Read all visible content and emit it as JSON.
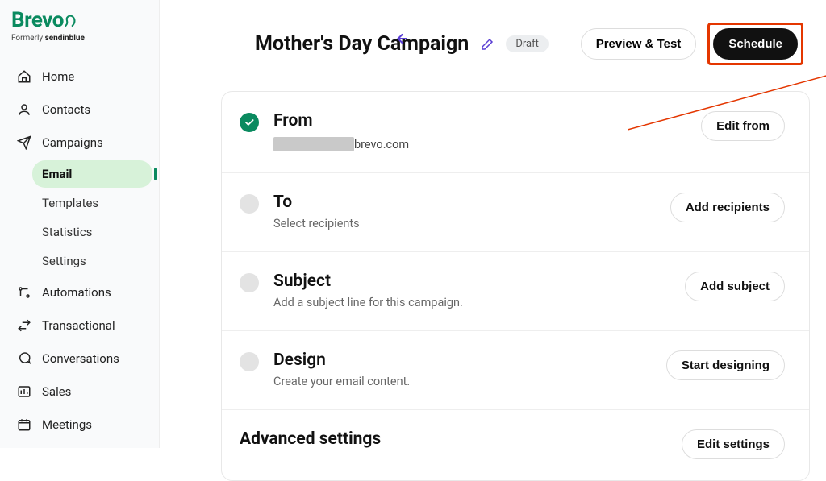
{
  "logo": {
    "name": "Brevo",
    "subline_prefix": "Formerly ",
    "subline_brand": "sendinblue"
  },
  "sidebar": {
    "items": [
      {
        "label": "Home"
      },
      {
        "label": "Contacts"
      },
      {
        "label": "Campaigns"
      },
      {
        "label": "Automations"
      },
      {
        "label": "Transactional"
      },
      {
        "label": "Conversations"
      },
      {
        "label": "Sales"
      },
      {
        "label": "Meetings"
      }
    ],
    "campaigns_sub": [
      {
        "label": "Email",
        "active": true
      },
      {
        "label": "Templates"
      },
      {
        "label": "Statistics"
      },
      {
        "label": "Settings"
      }
    ]
  },
  "header": {
    "title": "Mother's Day Campaign",
    "status_pill": "Draft",
    "preview_btn": "Preview & Test",
    "schedule_btn": "Schedule"
  },
  "sections": {
    "from": {
      "title": "From",
      "value_suffix": "brevo.com",
      "button": "Edit from"
    },
    "to": {
      "title": "To",
      "sub": "Select recipients",
      "button": "Add recipients"
    },
    "subject": {
      "title": "Subject",
      "sub": "Add a subject line for this campaign.",
      "button": "Add subject"
    },
    "design": {
      "title": "Design",
      "sub": "Create your email content.",
      "button": "Start designing"
    },
    "advanced": {
      "title": "Advanced settings",
      "button": "Edit settings"
    }
  },
  "colors": {
    "accent_green": "#0a8a5f",
    "annotation": "#e43600",
    "purple": "#5a3fd4"
  }
}
